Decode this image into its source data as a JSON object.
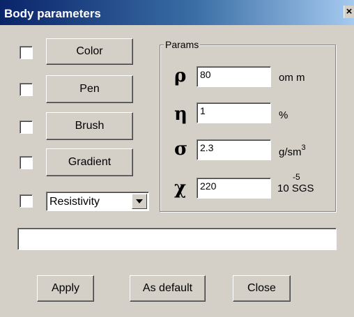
{
  "window": {
    "title": "Body parameters",
    "close_glyph": "×"
  },
  "left_panel": {
    "buttons": [
      {
        "label": "Color",
        "checked": false
      },
      {
        "label": "Pen",
        "checked": false
      },
      {
        "label": "Brush",
        "checked": false
      },
      {
        "label": "Gradient",
        "checked": false
      }
    ],
    "dropdown": {
      "selected": "Resistivity",
      "checked": false
    }
  },
  "params": {
    "legend": "Params",
    "rows": [
      {
        "symbol": "ρ",
        "value": "80",
        "unit": "om m"
      },
      {
        "symbol": "η",
        "value": "1",
        "unit": "%"
      },
      {
        "symbol": "σ",
        "value": "2.3",
        "unit": "g/sm",
        "unit_sup": "3"
      },
      {
        "symbol": "χ",
        "value": "220",
        "unit": "10 SGS",
        "unit_sup": "-5"
      }
    ]
  },
  "status_field": {
    "value": ""
  },
  "footer": {
    "apply": "Apply",
    "as_default": "As default",
    "close": "Close"
  },
  "colors": {
    "title_start": "#0a246a",
    "title_end": "#a6caf0",
    "face": "#d4d0c8"
  }
}
